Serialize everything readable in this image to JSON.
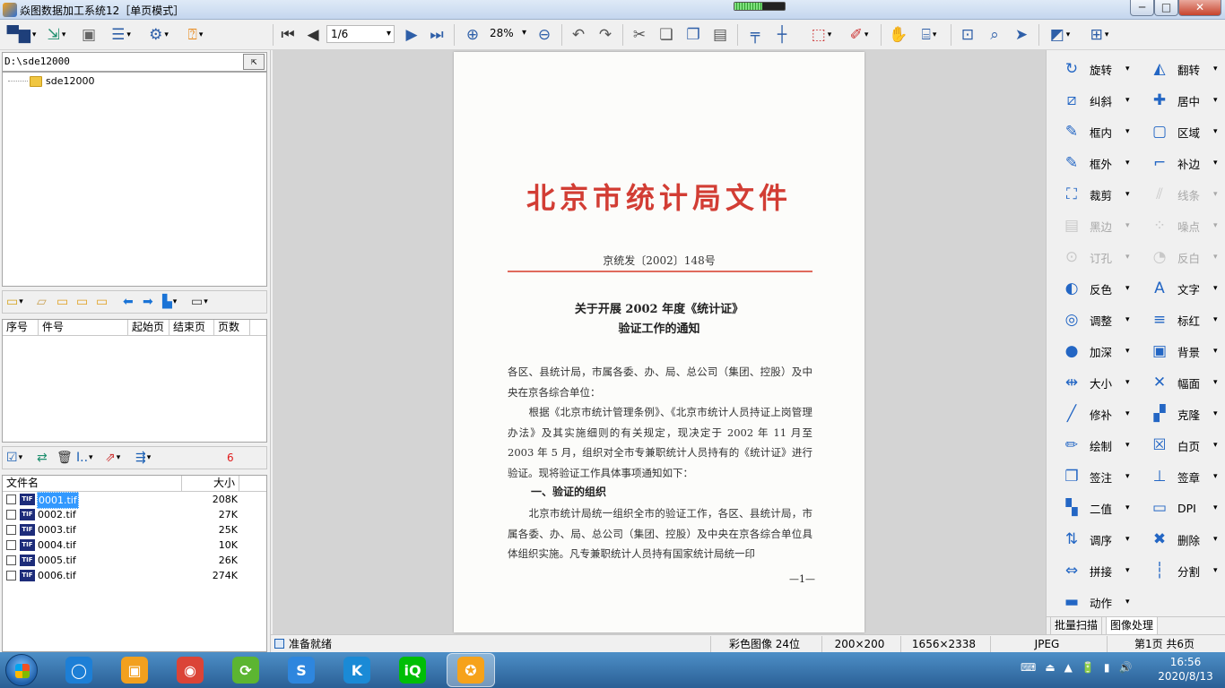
{
  "window": {
    "title": "焱图数据加工系统12［单页模式］",
    "min_label": "─",
    "max_label": "□",
    "close_label": "✕",
    "progress_fraction": 0.55
  },
  "toolbar": {
    "page_value": "1/6",
    "zoom_value": "28%"
  },
  "left": {
    "path": "D:\\sde12000",
    "up_glyph": "⇱",
    "tree": [
      {
        "label": "sde12000"
      }
    ],
    "doc_columns": [
      "序号",
      "件号",
      "起始页",
      "结束页",
      "页数"
    ],
    "file_count": "6",
    "file_columns": [
      "文件名",
      "大小"
    ],
    "files": [
      {
        "name": "0001.tif",
        "size": "208K",
        "selected": true
      },
      {
        "name": "0002.tif",
        "size": "27K",
        "selected": false
      },
      {
        "name": "0003.tif",
        "size": "25K",
        "selected": false
      },
      {
        "name": "0004.tif",
        "size": "10K",
        "selected": false
      },
      {
        "name": "0005.tif",
        "size": "26K",
        "selected": false
      },
      {
        "name": "0006.tif",
        "size": "274K",
        "selected": false
      }
    ],
    "tif_badge": "TIF"
  },
  "document": {
    "header": "北京市统计局文件",
    "number": "京统发〔2002〕148号",
    "title_line1": "关于开展 2002 年度《统计证》",
    "title_line2": "验证工作的通知",
    "para1": "各区、县统计局，市属各委、办、局、总公司（集团、控股）及中央在京各综合单位：",
    "para2": "　　根据《北京市统计管理条例》、《北京市统计人员持证上岗管理办法》及其实施细则的有关规定，现决定于 2002 年 11 月至 2003 年 5 月，组织对全市专兼职统计人员持有的《统计证》进行验证。现将验证工作具体事项通知如下：",
    "section1": "一、验证的组织",
    "para3": "　　北京市统计局统一组织全市的验证工作，各区、县统计局，市属各委、办、局、总公司（集团、控股）及中央在京各综合单位具体组织实施。凡专兼职统计人员持有国家统计局统一印",
    "page_no": "—1—"
  },
  "right": {
    "tools": [
      {
        "label": "旋转",
        "icon": "rotate-icon",
        "glyph": "↻",
        "enabled": true
      },
      {
        "label": "翻转",
        "icon": "flip-icon",
        "glyph": "◭",
        "enabled": true
      },
      {
        "label": "纠斜",
        "icon": "deskew-icon",
        "glyph": "⧄",
        "enabled": true
      },
      {
        "label": "居中",
        "icon": "center-icon",
        "glyph": "✚",
        "enabled": true
      },
      {
        "label": "框内",
        "icon": "erase-inside-icon",
        "glyph": "✎",
        "enabled": true
      },
      {
        "label": "区域",
        "icon": "region-icon",
        "glyph": "▢",
        "enabled": true
      },
      {
        "label": "框外",
        "icon": "erase-outside-icon",
        "glyph": "✎",
        "enabled": true
      },
      {
        "label": "补边",
        "icon": "pad-border-icon",
        "glyph": "⌐",
        "enabled": true
      },
      {
        "label": "裁剪",
        "icon": "crop-icon",
        "glyph": "⛶",
        "enabled": true
      },
      {
        "label": "线条",
        "icon": "line-icon",
        "glyph": "⫽",
        "enabled": false
      },
      {
        "label": "黑边",
        "icon": "black-border-icon",
        "glyph": "▤",
        "enabled": false
      },
      {
        "label": "噪点",
        "icon": "noise-icon",
        "glyph": "⁘",
        "enabled": false
      },
      {
        "label": "订孔",
        "icon": "punch-hole-icon",
        "glyph": "⊙",
        "enabled": false
      },
      {
        "label": "反白",
        "icon": "reverse-white-icon",
        "glyph": "◔",
        "enabled": false
      },
      {
        "label": "反色",
        "icon": "invert-icon",
        "glyph": "◐",
        "enabled": true
      },
      {
        "label": "文字",
        "icon": "text-icon",
        "glyph": "A",
        "enabled": true
      },
      {
        "label": "调整",
        "icon": "adjust-icon",
        "glyph": "◎",
        "enabled": true
      },
      {
        "label": "标红",
        "icon": "mark-red-icon",
        "glyph": "≡",
        "enabled": true
      },
      {
        "label": "加深",
        "icon": "darken-icon",
        "glyph": "●",
        "enabled": true
      },
      {
        "label": "背景",
        "icon": "background-icon",
        "glyph": "▣",
        "enabled": true
      },
      {
        "label": "大小",
        "icon": "size-icon",
        "glyph": "⇹",
        "enabled": true
      },
      {
        "label": "幅面",
        "icon": "page-size-icon",
        "glyph": "✕",
        "enabled": true
      },
      {
        "label": "修补",
        "icon": "repair-icon",
        "glyph": "╱",
        "enabled": true
      },
      {
        "label": "克隆",
        "icon": "clone-icon",
        "glyph": "▞",
        "enabled": true
      },
      {
        "label": "绘制",
        "icon": "draw-icon",
        "glyph": "✏",
        "enabled": true
      },
      {
        "label": "白页",
        "icon": "blank-page-icon",
        "glyph": "☒",
        "enabled": true
      },
      {
        "label": "签注",
        "icon": "annotate-icon",
        "glyph": "❐",
        "enabled": true
      },
      {
        "label": "签章",
        "icon": "stamp-icon",
        "glyph": "⊥",
        "enabled": true
      },
      {
        "label": "二值",
        "icon": "binarize-icon",
        "glyph": "▚",
        "enabled": true
      },
      {
        "label": "DPI",
        "icon": "dpi-icon",
        "glyph": "▭",
        "enabled": true
      },
      {
        "label": "调序",
        "icon": "reorder-icon",
        "glyph": "⇅",
        "enabled": true
      },
      {
        "label": "删除",
        "icon": "delete-icon",
        "glyph": "✖",
        "enabled": true
      },
      {
        "label": "拼接",
        "icon": "join-icon",
        "glyph": "⇔",
        "enabled": true
      },
      {
        "label": "分割",
        "icon": "split-icon",
        "glyph": "┆",
        "enabled": true
      },
      {
        "label": "动作",
        "icon": "action-icon",
        "glyph": "▬",
        "enabled": true
      }
    ],
    "tabs": [
      "批量扫描",
      "图像处理"
    ]
  },
  "status": {
    "ready": "准备就绪",
    "color_mode": "彩色图像 24位",
    "dpi": "200×200",
    "dimensions": "1656×2338",
    "format": "JPEG",
    "page_info": "第1页 共6页"
  },
  "taskbar": {
    "apps": [
      {
        "name": "browser-app-icon",
        "glyph": "◯",
        "color": "#1d7fd6"
      },
      {
        "name": "store-app-icon",
        "glyph": "▣",
        "color": "#f2a01e"
      },
      {
        "name": "chrome-icon",
        "glyph": "◉",
        "color": "#db4437"
      },
      {
        "name": "sync-app-icon",
        "glyph": "⟳",
        "color": "#5cb531"
      },
      {
        "name": "sogou-icon",
        "glyph": "S",
        "color": "#2e86de"
      },
      {
        "name": "k-app-icon",
        "glyph": "K",
        "color": "#1a8ad6"
      },
      {
        "name": "iqiyi-icon",
        "glyph": "iQ",
        "color": "#00be06"
      },
      {
        "name": "yantu-app-icon",
        "glyph": "✪",
        "color": "#f6a21a"
      }
    ],
    "tray": [
      "⌨",
      "⏏",
      "▲",
      "🔋",
      "▮",
      "🔊"
    ],
    "time": "16:56",
    "date": "2020/8/13"
  }
}
